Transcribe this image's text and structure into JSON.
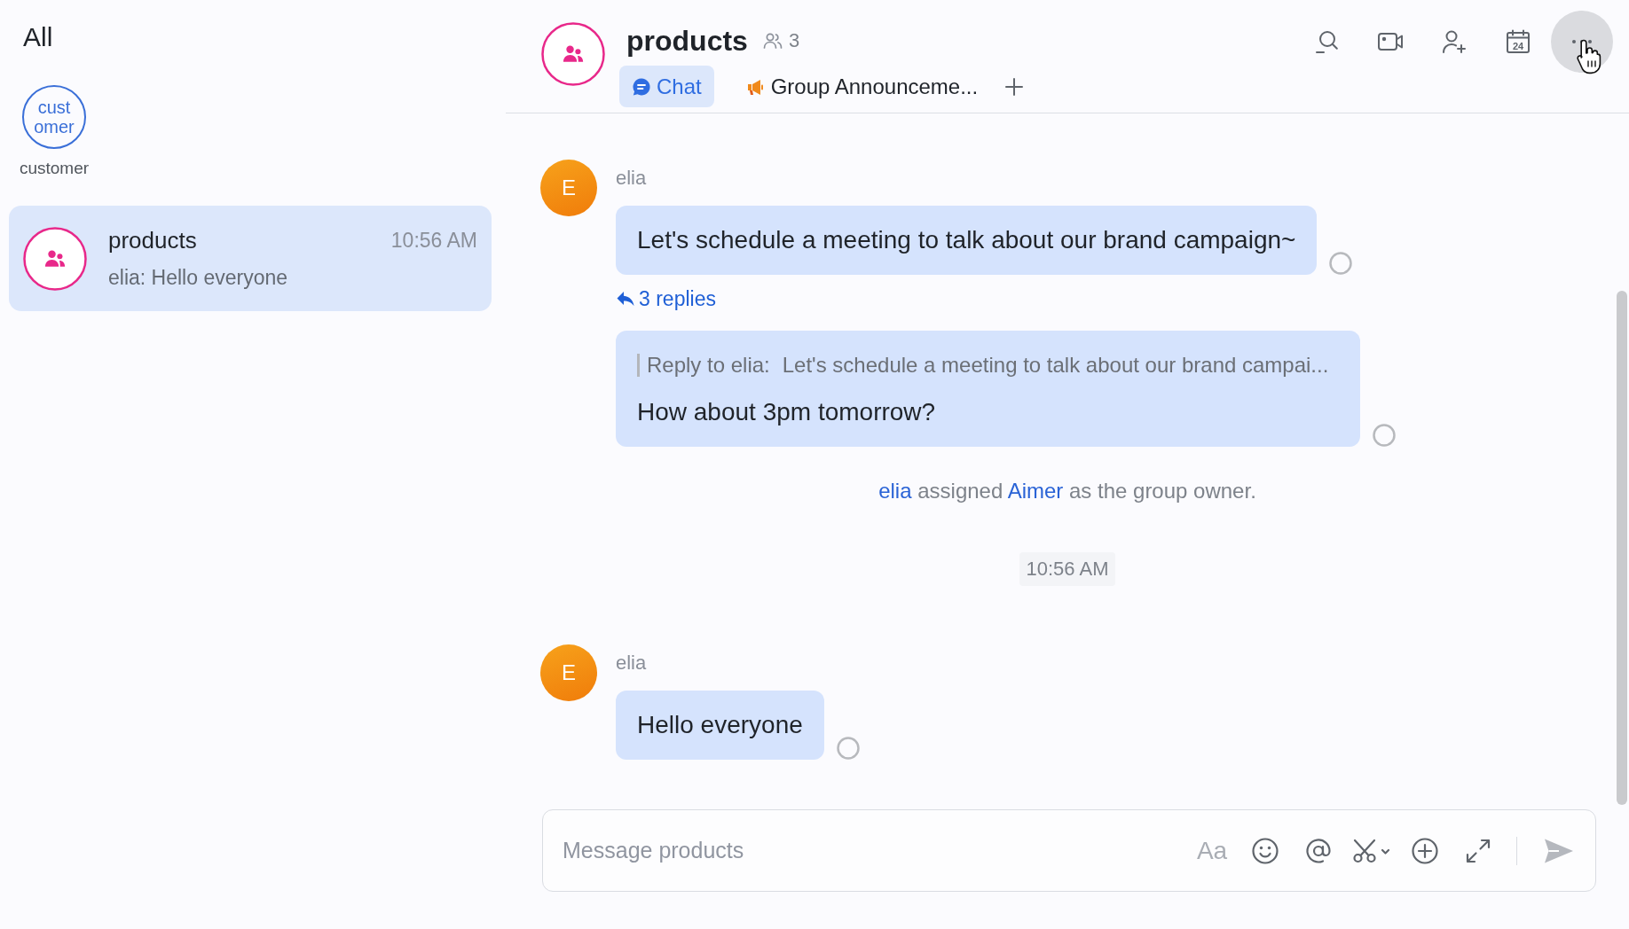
{
  "sidebar": {
    "title": "All",
    "shortcuts": [
      {
        "avatar_lines": [
          "cust",
          "omer"
        ],
        "label": "customer"
      }
    ],
    "conversations": [
      {
        "name": "products",
        "time": "10:56 AM",
        "preview": "elia: Hello everyone",
        "selected": true
      }
    ]
  },
  "chat": {
    "header": {
      "title": "products",
      "member_count": "3",
      "tabs": [
        {
          "kind": "chat",
          "label": "Chat",
          "selected": true
        },
        {
          "kind": "announcement",
          "label": "Group Announceme...",
          "selected": false
        }
      ],
      "actions": [
        {
          "kind": "search",
          "hovered": false
        },
        {
          "kind": "video",
          "hovered": false
        },
        {
          "kind": "add_member",
          "hovered": false
        },
        {
          "kind": "calendar",
          "day": "24",
          "hovered": false
        },
        {
          "kind": "more",
          "hovered": true
        }
      ]
    },
    "messages": [
      {
        "kind": "group",
        "sender": "elia",
        "avatar": "E",
        "bubbles": [
          {
            "text": "Let's schedule a meeting to talk about our brand campaign~",
            "replies": "3 replies",
            "read": false
          },
          {
            "quote_label": "Reply to elia:",
            "quote_text": "Let's schedule a meeting to talk about our brand campai...",
            "text": "How about 3pm tomorrow?",
            "read": false
          }
        ]
      },
      {
        "kind": "system",
        "parts": [
          {
            "text": "elia",
            "link": true
          },
          {
            "text": "assigned",
            "link": false
          },
          {
            "text": "Aimer",
            "link": true
          },
          {
            "text": "as the group owner.",
            "link": false
          }
        ]
      },
      {
        "kind": "time",
        "text": "10:56 AM"
      },
      {
        "kind": "group",
        "sender": "elia",
        "avatar": "E",
        "bubbles": [
          {
            "text": "Hello everyone",
            "read": false
          }
        ]
      }
    ],
    "composer": {
      "placeholder": "Message products",
      "tools": [
        {
          "kind": "format",
          "label": "Aa"
        },
        {
          "kind": "emoji"
        },
        {
          "kind": "mention"
        },
        {
          "kind": "screenshot"
        },
        {
          "kind": "attach"
        },
        {
          "kind": "expand"
        }
      ]
    }
  }
}
